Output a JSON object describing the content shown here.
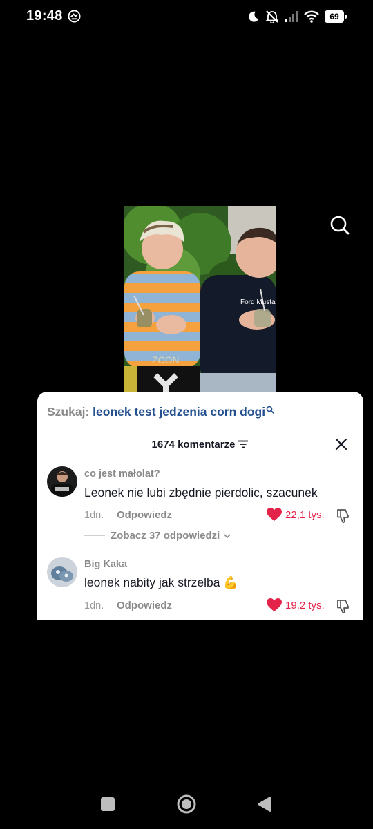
{
  "status_bar": {
    "time": "19:48",
    "battery": "69",
    "battery_level": 0.69
  },
  "video": {
    "shirt_text_left": "ZCON",
    "shirt_text_right": "Ford Mustang"
  },
  "comments_sheet": {
    "search_prefix": "Szukaj:",
    "search_query": "leonek test jedzenia corn dogi",
    "comment_count": "1674 komentarze",
    "comments": [
      {
        "username": "co jest małolat?",
        "text": "Leonek nie lubi zbędnie pierdolic, szacunek",
        "age": "1dn.",
        "reply_label": "Odpowiedz",
        "likes": "22,1 tys.",
        "view_replies": "Zobacz 37 odpowiedzi"
      },
      {
        "username": "Big Kaka",
        "text": "leonek nabity jak strzelba 💪",
        "age": "1dn.",
        "reply_label": "Odpowiedz",
        "likes": "19,2 tys."
      }
    ]
  },
  "colors": {
    "accent_link": "#24508f",
    "like_red": "#e4234b",
    "background": "#000000"
  }
}
